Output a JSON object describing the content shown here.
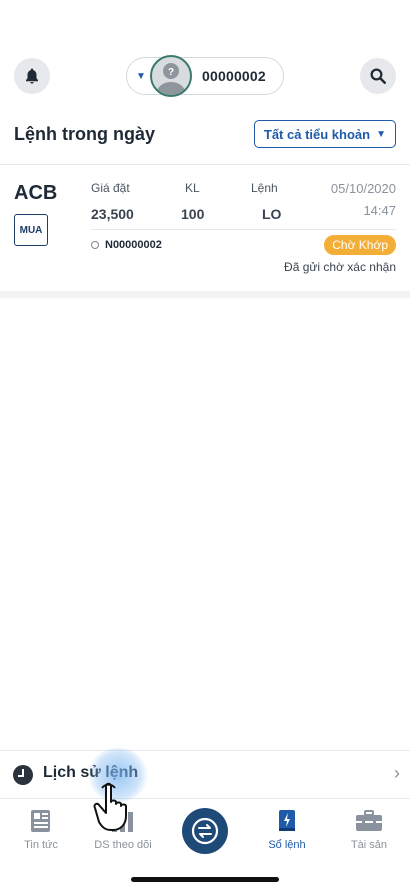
{
  "header": {
    "account_number": "00000002",
    "avatar_mark": "?"
  },
  "section": {
    "title": "Lệnh trong ngày",
    "subaccount_filter": "Tất cả tiểu khoản"
  },
  "order": {
    "symbol": "ACB",
    "side": "MUA",
    "price_label": "Giá đặt",
    "price_value": "23,500",
    "qty_label": "KL",
    "qty_value": "100",
    "type_label": "Lệnh",
    "type_value": "LO",
    "date": "05/10/2020",
    "time": "14:47",
    "order_id": "N00000002",
    "status": "Chờ Khớp",
    "status_note": "Đã gửi chờ xác nhận"
  },
  "history": {
    "label": "Lịch sử lệnh"
  },
  "tabs": [
    {
      "label": "Tin tức",
      "icon": "newspaper-icon"
    },
    {
      "label": "DS theo dõi",
      "icon": "watchlist-icon"
    },
    {
      "label": "",
      "icon": "exchange-icon"
    },
    {
      "label": "Sổ lệnh",
      "icon": "order-book-icon"
    },
    {
      "label": "Tài sản",
      "icon": "briefcase-icon"
    }
  ],
  "colors": {
    "accent": "#1f5aa8",
    "status_pending": "#f2ae37",
    "center_button": "#1e4a78"
  }
}
